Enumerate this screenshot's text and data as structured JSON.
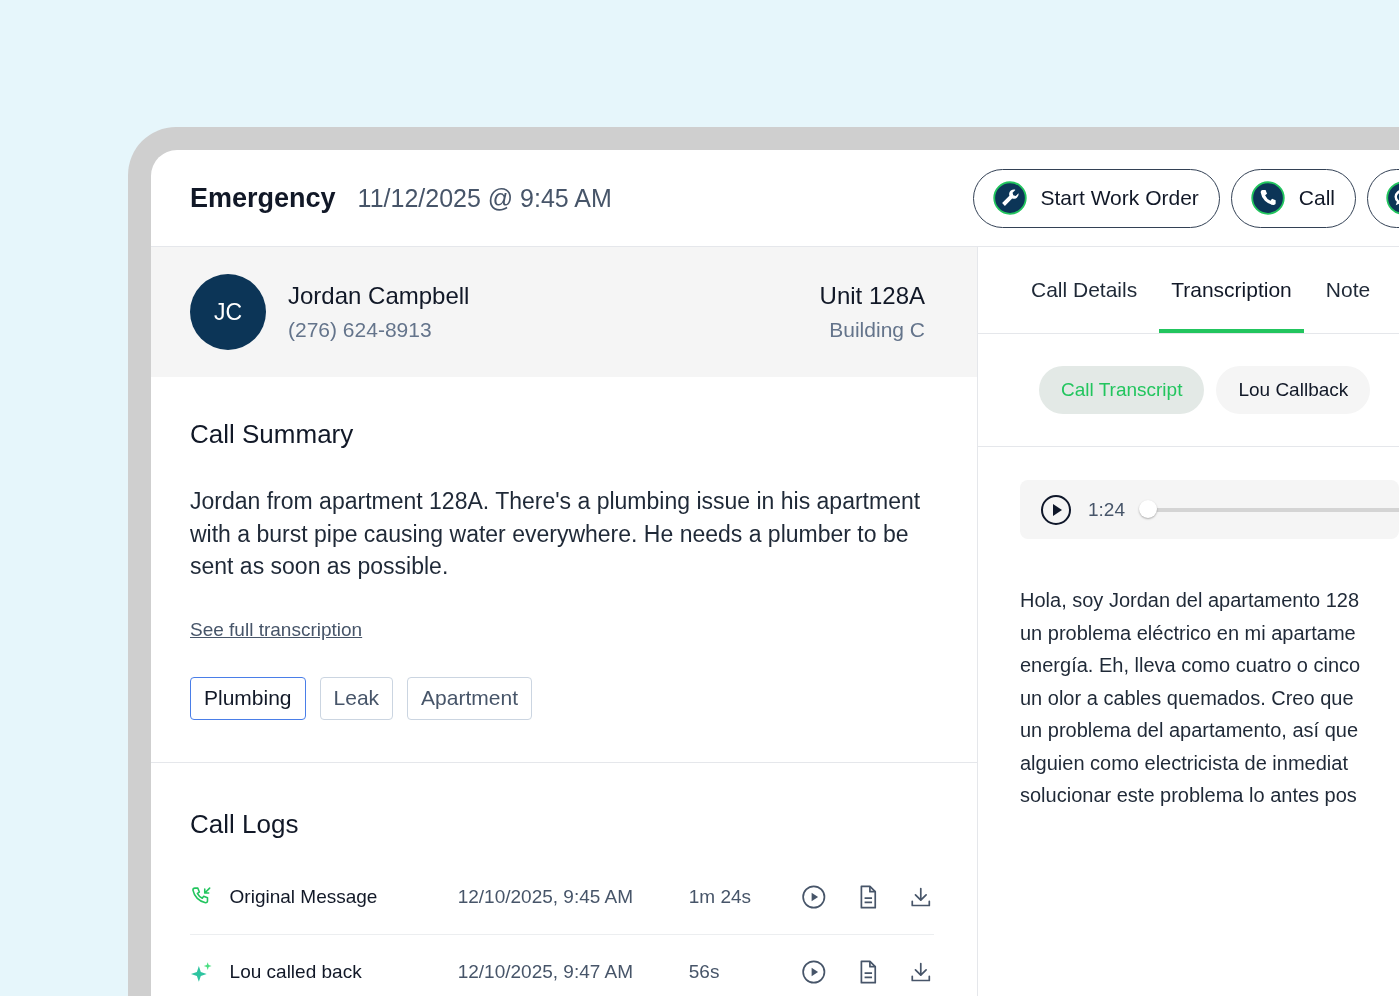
{
  "header": {
    "title": "Emergency",
    "datetime": "11/12/2025 @ 9:45 AM",
    "actions": [
      {
        "kind": "wrench",
        "label": "Start Work Order"
      },
      {
        "kind": "phone",
        "label": "Call"
      },
      {
        "kind": "chat"
      }
    ]
  },
  "contact": {
    "initials": "JC",
    "name": "Jordan Campbell",
    "phone": "(276) 624-8913",
    "unit": "Unit 128A",
    "building": "Building C"
  },
  "summary": {
    "title": "Call Summary",
    "text": "Jordan from apartment 128A. There's a plumbing issue in his apartment with a burst pipe causing water everywhere. He needs a plumber to be sent as soon as possible.",
    "link": "See full transcription",
    "tags": [
      {
        "label": "Plumbing",
        "selected": true
      },
      {
        "label": "Leak",
        "selected": false
      },
      {
        "label": "Apartment",
        "selected": false
      }
    ]
  },
  "call_logs": {
    "title": "Call Logs",
    "rows": [
      {
        "kind": "inbound",
        "label": "Original Message",
        "datetime": "12/10/2025, 9:45 AM",
        "duration": "1m 24s"
      },
      {
        "kind": "ai",
        "label": "Lou called back",
        "datetime": "12/10/2025, 9:47 AM",
        "duration": "56s"
      }
    ]
  },
  "tabs": [
    {
      "label": "Call Details",
      "selected": false
    },
    {
      "label": "Transcription",
      "selected": true
    },
    {
      "label": "Note",
      "selected": false
    }
  ],
  "subtabs": [
    {
      "label": "Call Transcript",
      "selected": true
    },
    {
      "label": "Lou Callback",
      "selected": false
    }
  ],
  "player": {
    "time": "1:24",
    "level": 0
  },
  "transcript_lines": [
    "Hola, soy Jordan del apartamento 128",
    "un problema eléctrico en mi apartame",
    "energía. Eh, lleva como cuatro o cinco",
    "un olor a cables quemados. Creo que",
    "un problema del apartamento, así que",
    "alguien como electricista de inmediat",
    "solucionar este problema lo antes pos"
  ]
}
